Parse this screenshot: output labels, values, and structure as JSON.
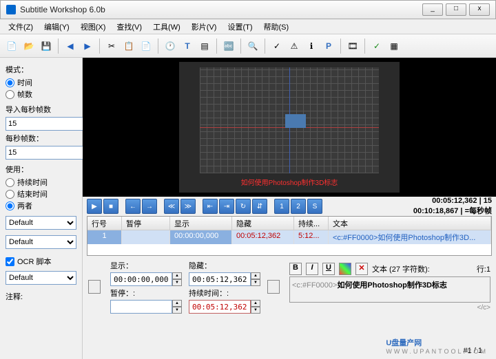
{
  "window": {
    "title": "Subtitle Workshop 6.0b",
    "min": "_",
    "max": "□",
    "close": "x"
  },
  "menu": [
    "文件(Z)",
    "编辑(Y)",
    "视图(X)",
    "查找(V)",
    "工具(W)",
    "影片(V)",
    "设置(T)",
    "帮助(S)"
  ],
  "sidebar": {
    "mode_label": "模式：",
    "mode_time": "时间",
    "mode_frames": "帧数",
    "input_fps_label": "导入每秒帧数",
    "input_fps": "15",
    "fps_label": "每秒帧数：",
    "fps": "15",
    "use_label": "使用：",
    "use_duration": "持续时间",
    "use_end": "结束时间",
    "use_both": "两者",
    "combo1": "Default",
    "combo2": "Default",
    "ocr_label": "OCR 脚本",
    "combo3": "Default",
    "notes_label": "注释:"
  },
  "video": {
    "subtitle_overlay": "如何使用Photoshop制作3D标志"
  },
  "playback": {
    "time1": "00:05:12,362",
    "time2": "00:10:18,867",
    "fps_num": "15",
    "fps_unit": "=每秒帧"
  },
  "grid": {
    "headers": [
      "行号",
      "暂停",
      "显示",
      "隐藏",
      "持续...",
      "文本"
    ],
    "row": {
      "num": "1",
      "pause": "",
      "show": "00:00:00,000",
      "hide": "00:05:12,362",
      "dur": "5:12...",
      "text": "<c:#FF0000>如何使用Photoshop制作3D..."
    }
  },
  "editor": {
    "show_label": "显示：",
    "show_value": "00:00:00,000",
    "hide_label": "隐藏：",
    "hide_value": "00:05:12,362",
    "pause_label": "暂停：:",
    "dur_label": "持续时间：:",
    "dur_value": "00:05:12,362",
    "fmt_b": "B",
    "fmt_i": "I",
    "fmt_u": "U",
    "text_label": "文本 (27 字符数):",
    "line_label": "行:1",
    "tag_open": "<c:#FF0000>",
    "text_body": "如何使用Photoshop制作3D标志",
    "tag_close": "</c>"
  },
  "status": {
    "page": "#1 / 1"
  },
  "watermark": {
    "brand": "U盘量产网",
    "url": "WWW.UPANTOOL.COM"
  },
  "colors": {
    "accent_red": "#c00000",
    "link_blue": "#2060c0"
  }
}
